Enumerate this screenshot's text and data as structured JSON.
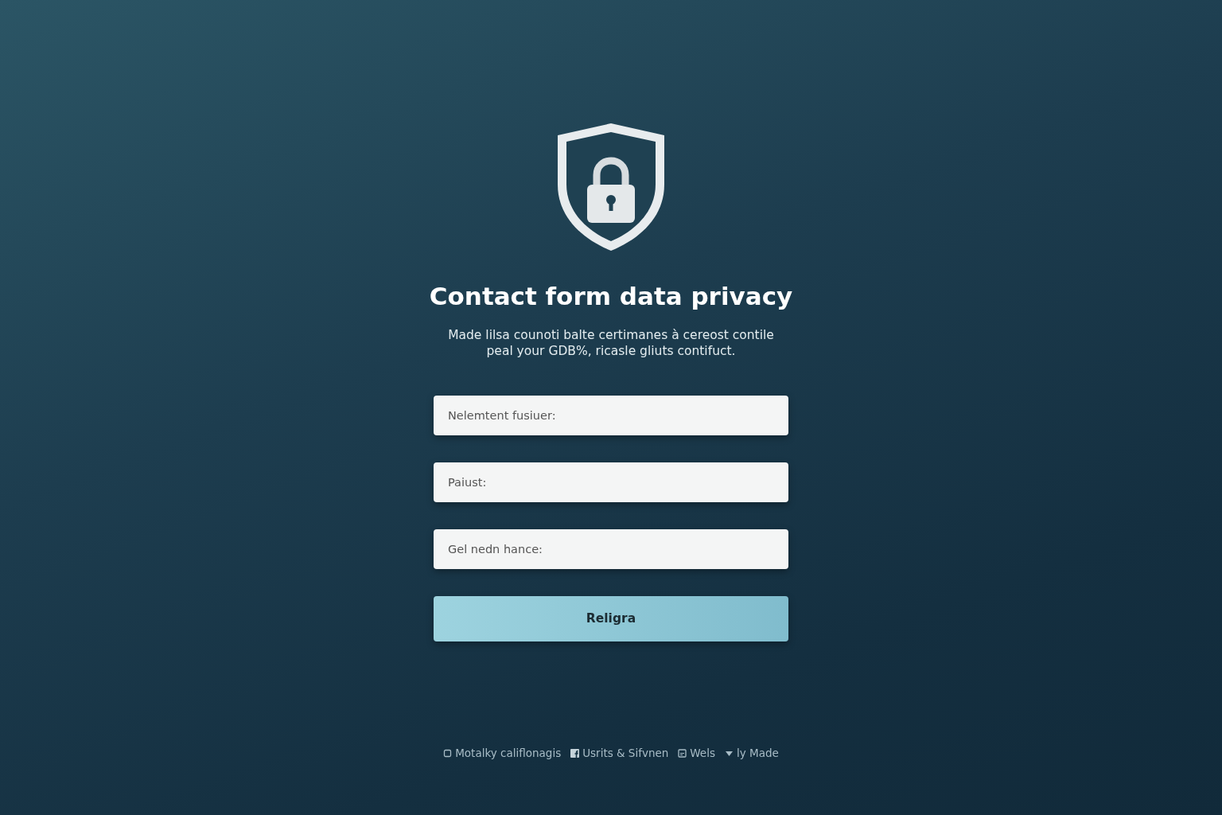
{
  "title": "Contact form data privacy",
  "subtitle": "Made lilsa counoti balte certimanes à cereost contile peal your GDB%, ricasle gliuts contifuct.",
  "fields": [
    {
      "placeholder": "Nelemtent fusiuer:"
    },
    {
      "placeholder": "Paiust:"
    },
    {
      "placeholder": "Gel nedn hance:"
    }
  ],
  "submit": "Religra",
  "footer_links": [
    {
      "kind": "square",
      "label": "Motalky califlonagis"
    },
    {
      "kind": "social",
      "label": "Usrits & Sifvnen"
    },
    {
      "kind": "page",
      "label": "Wels"
    },
    {
      "kind": "chevron",
      "label": "ly Made"
    }
  ]
}
